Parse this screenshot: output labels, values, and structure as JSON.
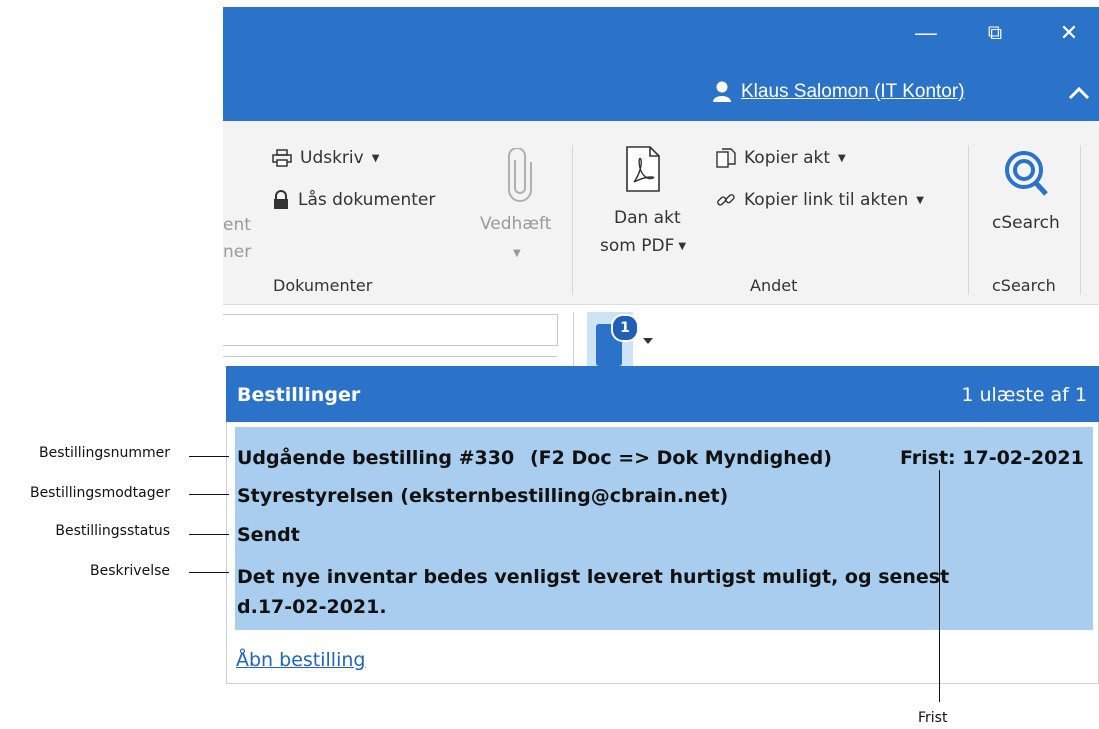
{
  "window": {
    "minimize_glyph": "—",
    "restore_glyph": "⧉",
    "close_glyph": "✕",
    "user_name": "Klaus Salomon (IT Kontor)",
    "collapse_glyph": "⌃"
  },
  "ribbon": {
    "cut_left_top": "ent",
    "cut_left_bottom": "ner",
    "print_label": "Udskriv",
    "lock_label": "Lås dokumenter",
    "attach_label": "Vedhæft",
    "group_documents": "Dokumenter",
    "pdf_label_1": "Dan akt",
    "pdf_label_2": "som PDF",
    "copy_act_label": "Kopier akt",
    "copy_link_label": "Kopier link til akten",
    "group_other": "Andet",
    "csearch_label": "cSearch",
    "group_csearch": "cSearch"
  },
  "notification": {
    "badge_count": "1"
  },
  "popup": {
    "title": "Bestillinger",
    "count_text": "1 ulæste af 1",
    "order_number": "Udgående bestilling #330",
    "order_route": "(F2 Doc => Dok Myndighed)",
    "deadline": "Frist: 17-02-2021",
    "recipient": "Styrestyrelsen (eksternbestilling@cbrain.net)",
    "status": "Sendt",
    "description_line1": "Det nye inventar bedes venligst leveret hurtigst muligt, og senest",
    "description_line2": "d.17-02-2021.",
    "open_link": "Åbn bestilling"
  },
  "annotations": {
    "order_number": "Bestillingsnummer",
    "recipient": "Bestillingsmodtager",
    "status": "Bestillingsstatus",
    "description": "Beskrivelse",
    "deadline": "Frist"
  },
  "colors": {
    "accent_blue": "#2a73c9",
    "order_bg": "#a8cdee",
    "link_blue": "#1f64c4"
  }
}
